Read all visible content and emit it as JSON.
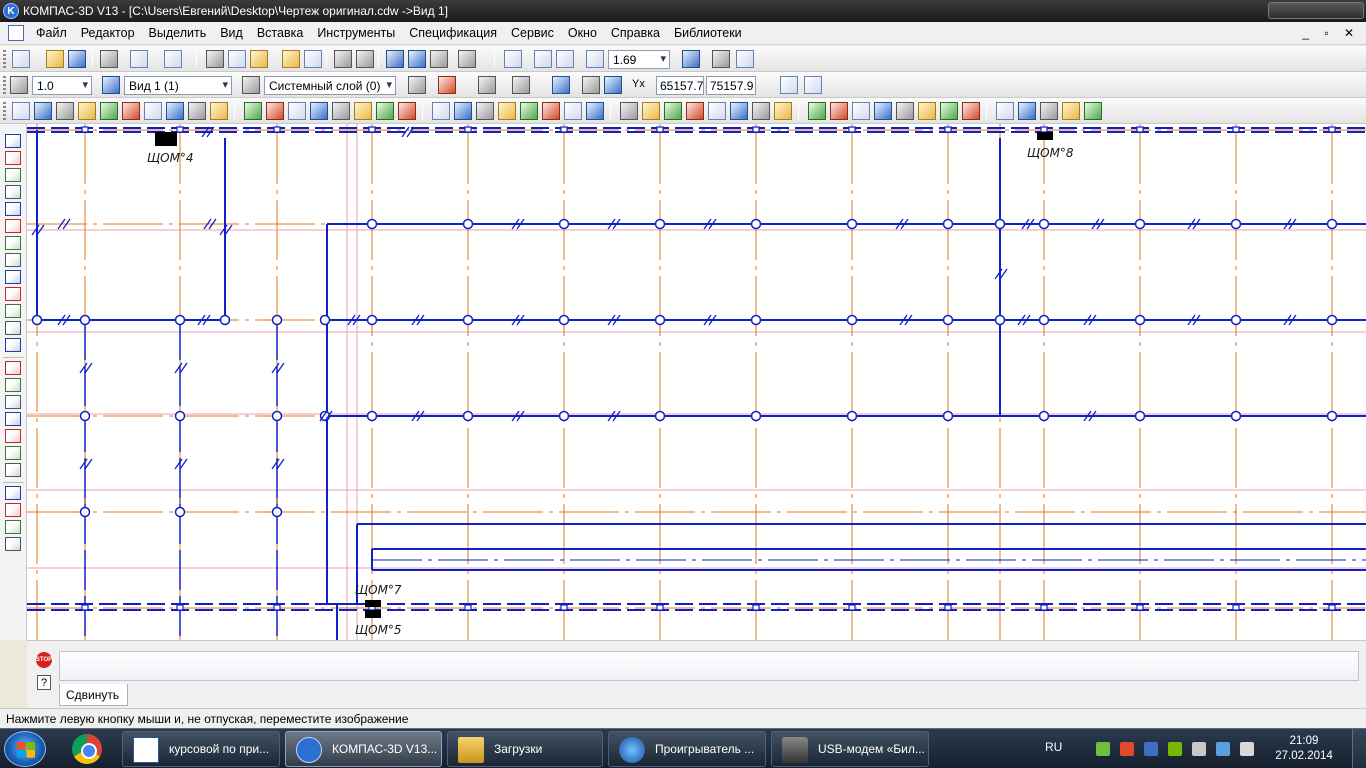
{
  "window": {
    "title": "КОМПАС-3D V13 - [C:\\Users\\Евгений\\Desktop\\Чертеж оригинал.cdw ->Вид 1]"
  },
  "menu": [
    "Файл",
    "Редактор",
    "Выделить",
    "Вид",
    "Вставка",
    "Инструменты",
    "Спецификация",
    "Сервис",
    "Окно",
    "Справка",
    "Библиотеки"
  ],
  "toolbar_standard": {
    "zoom_value": "1.69"
  },
  "toolbar_current_state": {
    "step_value": "1.0",
    "view_value": "Вид 1 (1)",
    "layer_value": "Системный слой (0)",
    "coord_x": "65157.7",
    "coord_y": "75157.9"
  },
  "drawing": {
    "panel_labels": [
      "ЩОМ°4",
      "ЩОМ°8",
      "ЩОМ°7",
      "ЩОМ°5"
    ]
  },
  "command": {
    "stop_label": "STOP",
    "help_label": "?",
    "tab_label": "Сдвинуть"
  },
  "status": {
    "message": "Нажмите левую кнопку мыши и, не отпуская, переместите изображение"
  },
  "taskbar": {
    "items": [
      {
        "label": "курсовой по при..."
      },
      {
        "label": "КОМПАС-3D V13..."
      },
      {
        "label": "Загрузки"
      },
      {
        "label": "Проигрыватель ..."
      },
      {
        "label": "USB-модем «Бил..."
      }
    ],
    "language": "RU",
    "time": "21:09",
    "date": "27.02.2014"
  },
  "colors": {
    "grid_orange": "#e07a1c",
    "wall_blue": "#1020c8",
    "guide_pink": "#e8a0b4",
    "guide_dark": "#6a1020"
  }
}
